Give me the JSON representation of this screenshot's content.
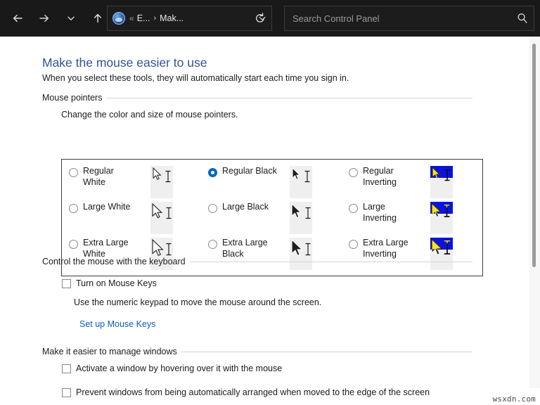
{
  "window": {
    "nav": {
      "back_label": "Back",
      "forward_label": "Forward",
      "recent_label": "Recent locations",
      "up_label": "Up"
    },
    "address": {
      "icon": "control-panel-globe-icon",
      "overflow_chevrons": "«",
      "crumb_1": "E...",
      "crumb_separator": "›",
      "crumb_2": "Mak...",
      "dropdown_icon": "chevron-down-icon",
      "refresh_icon": "refresh-icon"
    },
    "search": {
      "placeholder": "Search Control Panel",
      "value": "",
      "icon": "search-icon"
    }
  },
  "page": {
    "title": "Make the mouse easier to use",
    "subtitle": "When you select these tools, they will automatically start each time you sign in."
  },
  "sections": {
    "mouse_pointers": {
      "heading": "Mouse pointers",
      "helper": "Change the color and size of mouse pointers.",
      "options": [
        {
          "id": "regular-white",
          "label": "Regular\nWhite",
          "label_line1": "Regular",
          "label_line2": "White",
          "checked": false,
          "preview": "white"
        },
        {
          "id": "large-white",
          "label": "Large White",
          "label_line1": "Large White",
          "label_line2": "",
          "checked": false,
          "preview": "white"
        },
        {
          "id": "extra-large-white",
          "label": "Extra Large\nWhite",
          "label_line1": "Extra Large",
          "label_line2": "White",
          "checked": false,
          "preview": "white"
        },
        {
          "id": "regular-black",
          "label": "Regular Black",
          "label_line1": "Regular Black",
          "label_line2": "",
          "checked": true,
          "preview": "black"
        },
        {
          "id": "large-black",
          "label": "Large Black",
          "label_line1": "Large Black",
          "label_line2": "",
          "checked": false,
          "preview": "black"
        },
        {
          "id": "extra-large-black",
          "label": "Extra Large\nBlack",
          "label_line1": "Extra Large",
          "label_line2": "Black",
          "checked": false,
          "preview": "black"
        },
        {
          "id": "regular-inverting",
          "label": "Regular\nInverting",
          "label_line1": "Regular",
          "label_line2": "Inverting",
          "checked": false,
          "preview": "invert"
        },
        {
          "id": "large-inverting",
          "label": "Large\nInverting",
          "label_line1": "Large",
          "label_line2": "Inverting",
          "checked": false,
          "preview": "invert"
        },
        {
          "id": "extra-large-inverting",
          "label": "Extra Large\nInverting",
          "label_line1": "Extra Large",
          "label_line2": "Inverting",
          "checked": false,
          "preview": "invert"
        }
      ]
    },
    "keyboard_control": {
      "heading": "Control the mouse with the keyboard",
      "mouse_keys_label": "Turn on Mouse Keys",
      "mouse_keys_checked": false,
      "mouse_keys_description": "Use the numeric keypad to move the mouse around the screen.",
      "setup_link": "Set up Mouse Keys"
    },
    "manage_windows": {
      "heading": "Make it easier to manage windows",
      "items": [
        {
          "label": "Activate a window by hovering over it with the mouse",
          "checked": false
        },
        {
          "label": "Prevent windows from being automatically arranged when moved to the edge of the screen",
          "checked": false
        }
      ]
    }
  },
  "watermark": "wsxdn.com",
  "colors": {
    "titlebar_bg": "#191919",
    "accent_blue": "#0067c0",
    "title_text": "#2f5496",
    "link_blue": "#0d5ec1",
    "invert_band": "#0a12e0",
    "preview_bg": "#efefef"
  }
}
